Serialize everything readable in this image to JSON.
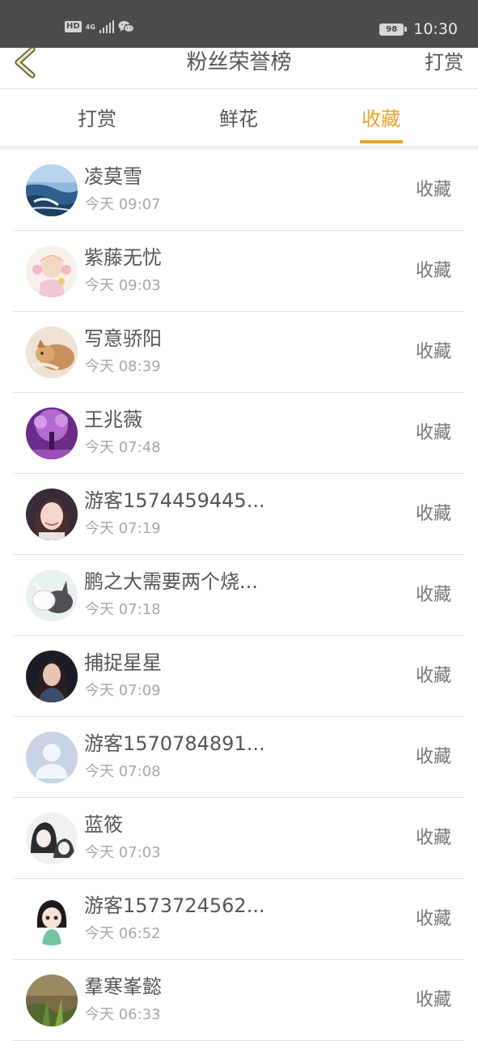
{
  "status_bar": {
    "hd_label": "HD",
    "network_label": "4G",
    "battery_level": "98",
    "time": "10:30",
    "icons": [
      "hd-icon",
      "signal-icon",
      "wechat-icon",
      "battery-icon"
    ]
  },
  "nav": {
    "title": "粉丝荣誉榜",
    "action_label": "打赏",
    "back_icon": "chevron-left-icon",
    "accent_color": "#eba228"
  },
  "tabs": [
    {
      "label": "打赏",
      "active": false
    },
    {
      "label": "鲜花",
      "active": false
    },
    {
      "label": "收藏",
      "active": true
    }
  ],
  "entries": [
    {
      "name": "凌莫雪",
      "time": "今天 09:07",
      "action": "收藏"
    },
    {
      "name": "紫藤无忧",
      "time": "今天 09:03",
      "action": "收藏"
    },
    {
      "name": "写意骄阳",
      "time": "今天 08:39",
      "action": "收藏"
    },
    {
      "name": "王兆薇",
      "time": "今天 07:48",
      "action": "收藏"
    },
    {
      "name": "游客1574459445...",
      "time": "今天 07:19",
      "action": "收藏"
    },
    {
      "name": "鹏之大需要两个烧...",
      "time": "今天 07:18",
      "action": "收藏"
    },
    {
      "name": "捕捉星星",
      "time": "今天 07:09",
      "action": "收藏"
    },
    {
      "name": "游客1570784891...",
      "time": "今天 07:08",
      "action": "收藏"
    },
    {
      "name": "蓝筱",
      "time": "今天 07:03",
      "action": "收藏"
    },
    {
      "name": "游客1573724562...",
      "time": "今天 06:52",
      "action": "收藏"
    },
    {
      "name": "羣寒峯懿",
      "time": "今天 06:33",
      "action": "收藏"
    }
  ]
}
